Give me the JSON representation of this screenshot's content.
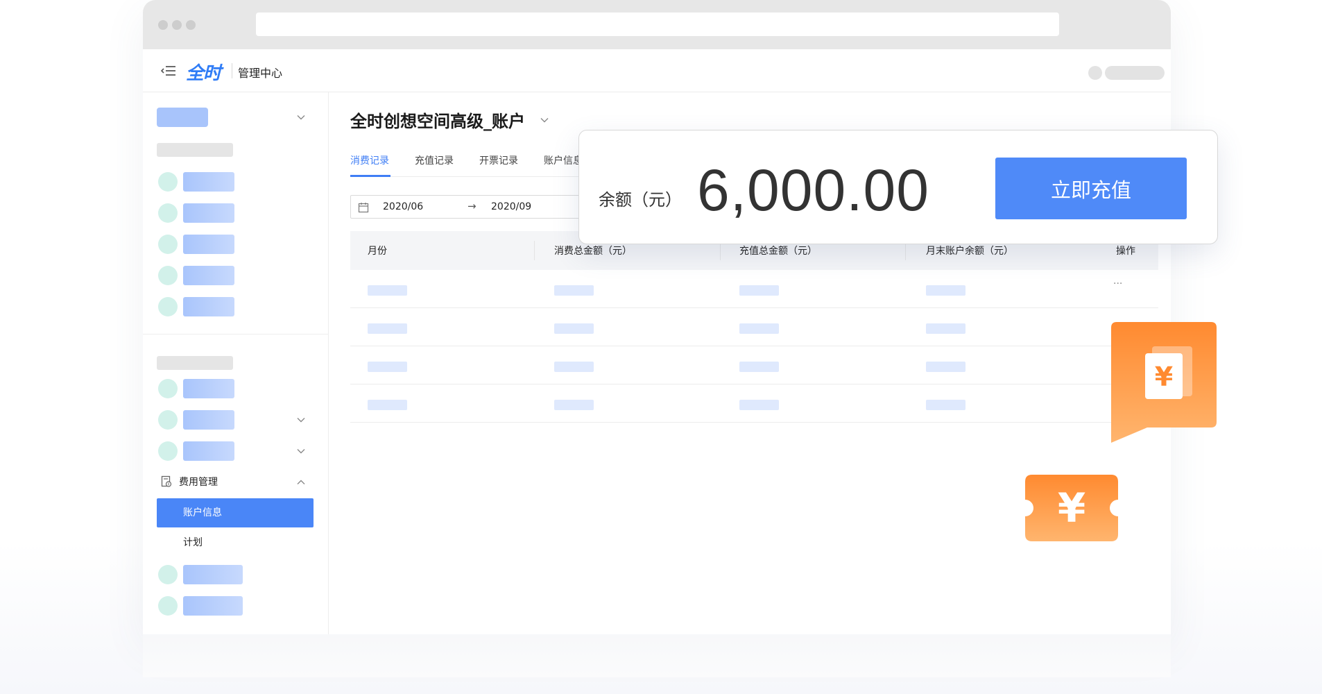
{
  "app": {
    "logo_text": "全时",
    "title": "管理中心"
  },
  "sidebar": {
    "fee_group_label": "费用管理",
    "active_item_label": "账户信息",
    "plan_item_label": "计划"
  },
  "main": {
    "account_title": "全时创想空间高级_账户",
    "tabs": [
      {
        "label": "消费记录",
        "active": true
      },
      {
        "label": "充值记录",
        "active": false
      },
      {
        "label": "开票记录",
        "active": false
      },
      {
        "label": "账户信息",
        "active": false
      }
    ],
    "date_range": {
      "start": "2020/06",
      "arrow": "→",
      "end": "2020/09"
    },
    "table": {
      "headers": [
        "月份",
        "消费总金额（元）",
        "充值总金额（元）",
        "月末账户余额（元）",
        "操作"
      ],
      "row_action": "···"
    }
  },
  "balance_card": {
    "label": "余额（元）",
    "value": "6,000.00",
    "button_label": "立即充值"
  },
  "colors": {
    "accent": "#4f8af8",
    "accent_dark": "#3f7ef5",
    "orange": "#ff8a30",
    "orange_light": "#ffb56e"
  },
  "icons": {
    "menu": "menu-collapse-icon",
    "calendar": "calendar-icon",
    "fee": "fee-document-icon",
    "yen_bubble": "yen-bubble-icon",
    "yen_ticket": "yen-ticket-icon"
  }
}
